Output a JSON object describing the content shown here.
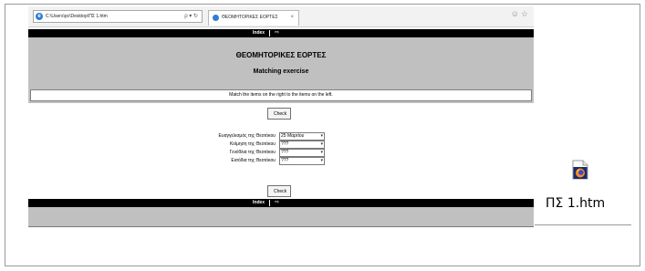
{
  "browser": {
    "address": "C:\\Users\\pc\\Desktop\\ΠΣ 1.htm",
    "address_controls": "ρ ▾ ↻",
    "tab_title": "ΘΕΟΜΗΤΟΡΙΚΕΣ ΕΟΡΤΕΣ",
    "tab_close": "×",
    "window_icons": "☺☆"
  },
  "page": {
    "nav": {
      "index_label": "Index",
      "arrow": "⇨"
    },
    "title": "ΘΕΟΜΗΤΟΡΙΚΕΣ ΕΟΡΤΕΣ",
    "subtitle": "Matching exercise",
    "instructions": "Match the items on the right to the items on the left.",
    "check_label": "Check",
    "questions": [
      {
        "label": "Ευαγγελισμός της Θεοτόκου",
        "selected": "25 Μαρτίου"
      },
      {
        "label": "Κοίμηση της Θεοτόκου",
        "selected": "???"
      },
      {
        "label": "Γενέθλια της Θεοτόκου",
        "selected": "???"
      },
      {
        "label": "Εισόδια της Θεοτόκου",
        "selected": "???"
      }
    ],
    "dropdown_arrow": "▾"
  },
  "desktop": {
    "file_name": "ΠΣ 1.htm",
    "file_icon": "firefox-file-icon"
  }
}
